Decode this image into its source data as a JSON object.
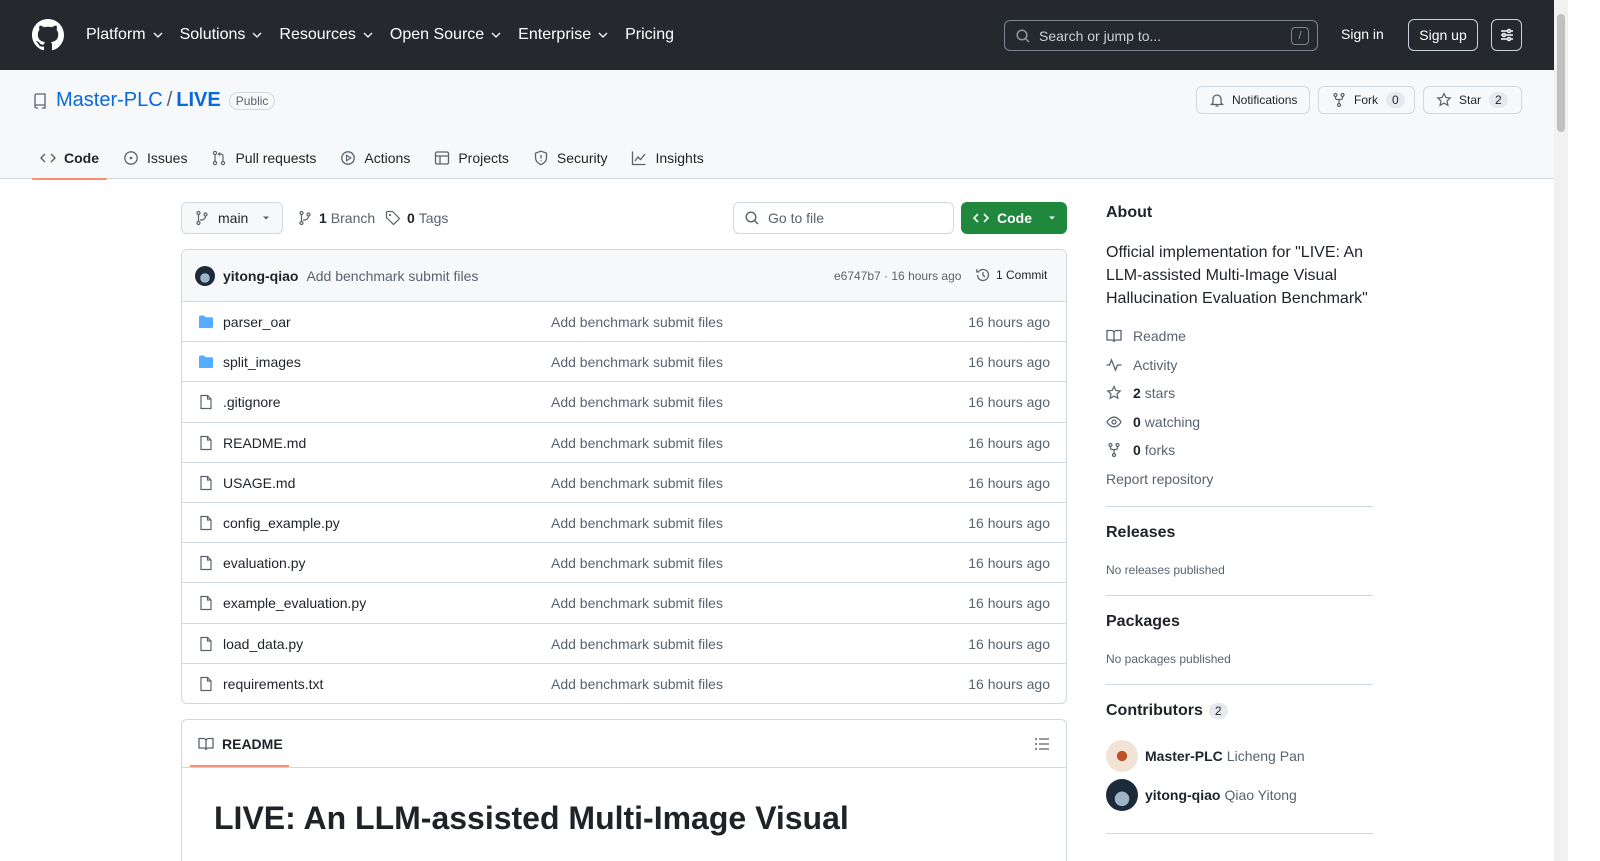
{
  "header": {
    "nav": [
      "Platform",
      "Solutions",
      "Resources",
      "Open Source",
      "Enterprise",
      "Pricing"
    ],
    "search_placeholder": "Search or jump to...",
    "search_shortcut": "/",
    "signin": "Sign in",
    "signup": "Sign up"
  },
  "repo": {
    "owner": "Master-PLC",
    "separator": "/",
    "name": "LIVE",
    "visibility": "Public",
    "notifications": "Notifications",
    "fork_label": "Fork",
    "fork_count": "0",
    "star_label": "Star",
    "star_count": "2",
    "tabs": [
      "Code",
      "Issues",
      "Pull requests",
      "Actions",
      "Projects",
      "Security",
      "Insights"
    ]
  },
  "toolbar": {
    "branch": "main",
    "branches_count": "1",
    "branches_label": "Branch",
    "tags_count": "0",
    "tags_label": "Tags",
    "goto_placeholder": "Go to file",
    "code_label": "Code"
  },
  "commit": {
    "author": "yitong-qiao",
    "message": "Add benchmark submit files",
    "sha_time": "e6747b7 · 16 hours ago",
    "commits": "1 Commit"
  },
  "files": [
    {
      "name": "parser_oar",
      "type": "dir",
      "message": "Add benchmark submit files",
      "age": "16 hours ago"
    },
    {
      "name": "split_images",
      "type": "dir",
      "message": "Add benchmark submit files",
      "age": "16 hours ago"
    },
    {
      "name": ".gitignore",
      "type": "file",
      "message": "Add benchmark submit files",
      "age": "16 hours ago"
    },
    {
      "name": "README.md",
      "type": "file",
      "message": "Add benchmark submit files",
      "age": "16 hours ago"
    },
    {
      "name": "USAGE.md",
      "type": "file",
      "message": "Add benchmark submit files",
      "age": "16 hours ago"
    },
    {
      "name": "config_example.py",
      "type": "file",
      "message": "Add benchmark submit files",
      "age": "16 hours ago"
    },
    {
      "name": "evaluation.py",
      "type": "file",
      "message": "Add benchmark submit files",
      "age": "16 hours ago"
    },
    {
      "name": "example_evaluation.py",
      "type": "file",
      "message": "Add benchmark submit files",
      "age": "16 hours ago"
    },
    {
      "name": "load_data.py",
      "type": "file",
      "message": "Add benchmark submit files",
      "age": "16 hours ago"
    },
    {
      "name": "requirements.txt",
      "type": "file",
      "message": "Add benchmark submit files",
      "age": "16 hours ago"
    }
  ],
  "readme": {
    "tab": "README",
    "heading": "LIVE: An LLM-assisted Multi-Image Visual"
  },
  "sidebar": {
    "about_title": "About",
    "description": "Official implementation for \"LIVE: An LLM-assisted Multi-Image Visual Hallucination Evaluation Benchmark\"",
    "readme": "Readme",
    "activity": "Activity",
    "stars_count": "2",
    "stars_label": "stars",
    "watching_count": "0",
    "watching_label": "watching",
    "forks_count": "0",
    "forks_label": "forks",
    "report": "Report repository",
    "releases_title": "Releases",
    "releases_sub": "No releases published",
    "packages_title": "Packages",
    "packages_sub": "No packages published",
    "contributors_title": "Contributors",
    "contributors_count": "2",
    "contributors": [
      {
        "login": "Master-PLC",
        "name": "Licheng Pan"
      },
      {
        "login": "yitong-qiao",
        "name": "Qiao Yitong"
      }
    ]
  },
  "colors": {
    "header_bg": "#25292e",
    "link": "#0969da",
    "primary_button": "#1f883d",
    "active_tab_underline": "#fd8c73",
    "folder_icon": "#54aeff"
  }
}
